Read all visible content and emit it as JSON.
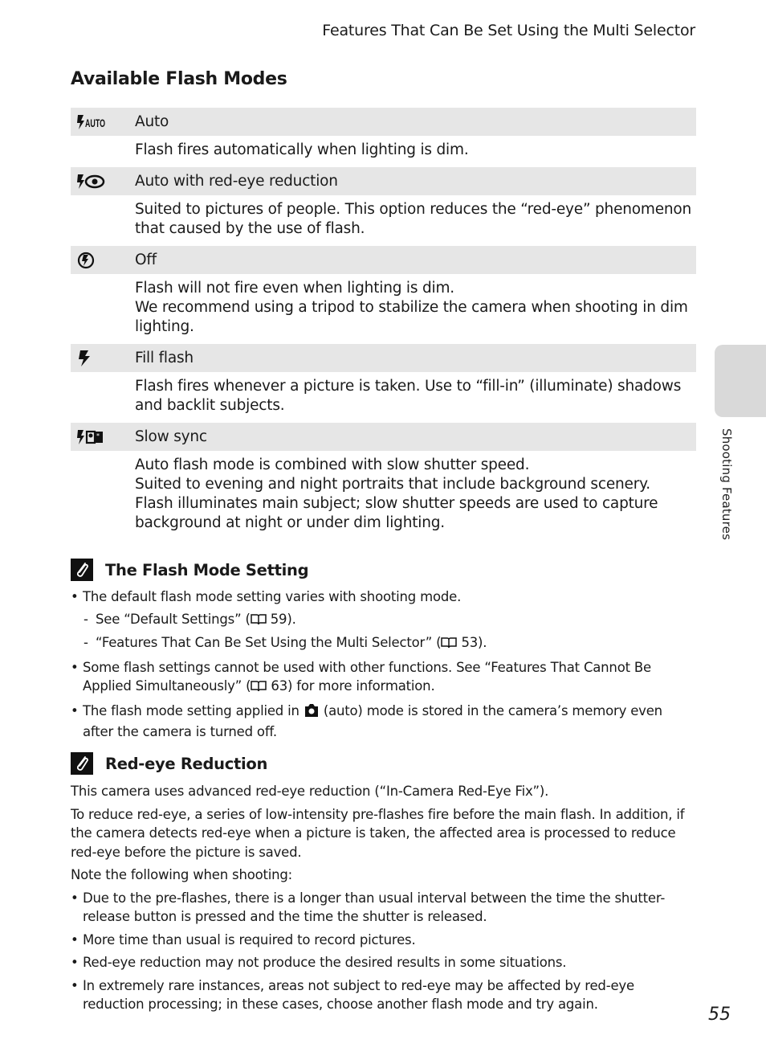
{
  "header": {
    "running_title": "Features That Can Be Set Using the Multi Selector"
  },
  "section": {
    "title": "Available Flash Modes"
  },
  "modes": [
    {
      "icon": "flash-auto-icon",
      "name": "Auto",
      "description": [
        "Flash fires automatically when lighting is dim."
      ]
    },
    {
      "icon": "flash-red-eye-icon",
      "name": "Auto with red-eye reduction",
      "description": [
        "Suited to pictures of people. This option reduces the “red-eye” phenomenon that caused by the use of flash."
      ]
    },
    {
      "icon": "flash-off-icon",
      "name": "Off",
      "description": [
        "Flash will not fire even when lighting is dim.",
        "We recommend using a tripod to stabilize the camera when shooting in dim lighting."
      ]
    },
    {
      "icon": "fill-flash-icon",
      "name": "Fill flash",
      "description": [
        "Flash fires whenever a picture is taken. Use to “fill-in” (illuminate) shadows and backlit subjects."
      ]
    },
    {
      "icon": "slow-sync-icon",
      "name": "Slow sync",
      "description": [
        "Auto flash mode is combined with slow shutter speed.",
        "Suited to evening and night portraits that include background scenery.",
        "Flash illuminates main subject; slow shutter speeds are used to capture background at night or under dim lighting."
      ]
    }
  ],
  "note1": {
    "title": "The Flash Mode Setting",
    "bullet1": "The default flash mode setting varies with shooting mode.",
    "sub1_pre": "See “Default Settings” (",
    "sub1_post": " 59).",
    "sub2_pre": "“Features That Can Be Set Using the Multi Selector” (",
    "sub2_post": " 53).",
    "bullet2_pre": "Some flash settings cannot be used with other functions. See “Features That Cannot Be Applied Simultaneously” (",
    "bullet2_post": " 63) for more information.",
    "bullet3_pre": "The flash mode setting applied in ",
    "bullet3_post": " (auto) mode is stored in the camera’s memory even after the camera is turned off."
  },
  "note2": {
    "title": "Red-eye Reduction",
    "para1": "This camera uses advanced red-eye reduction (“In-Camera Red-Eye Fix”).",
    "para2": "To reduce red-eye, a series of low-intensity pre-flashes fire before the main flash. In addition, if the camera detects red-eye when a picture is taken, the affected area is processed to reduce red-eye before the picture is saved.",
    "para3": "Note the following when shooting:",
    "bullets": [
      "Due to the pre-flashes, there is a longer than usual interval between the time the shutter-release button is pressed and the time the shutter is released.",
      "More time than usual is required to record pictures.",
      "Red-eye reduction may not produce the desired results in some situations.",
      "In extremely rare instances, areas not subject to red-eye may be affected by red-eye reduction processing; in these cases, choose another flash mode and try again."
    ]
  },
  "side": {
    "label": "Shooting Features"
  },
  "page": {
    "number": "55"
  }
}
